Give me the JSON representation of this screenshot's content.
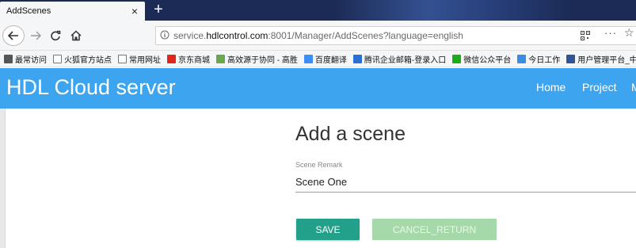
{
  "browser": {
    "tab_title": "AddScenes",
    "tab_close": "×",
    "new_tab": "+",
    "url_prefix": "service.",
    "url_domain": "hdlcontrol.com",
    "url_rest": ":8001/Manager/AddScenes?language=english",
    "more": "···",
    "star": "☆",
    "icons": {
      "back": "back-arrow-icon",
      "forward": "forward-arrow-icon",
      "reload": "reload-icon",
      "home": "home-icon",
      "info": "info-icon",
      "qr": "qr-code-icon",
      "star": "bookmark-star-icon"
    }
  },
  "bookmarks": [
    {
      "label": "最常访问",
      "icon": "gear-star-icon",
      "color": "#555555"
    },
    {
      "label": "火狐官方站点",
      "icon": "folder-icon",
      "color": "#777777"
    },
    {
      "label": "常用网址",
      "icon": "folder-icon",
      "color": "#777777"
    },
    {
      "label": "京东商城",
      "icon": "jd-icon",
      "color": "#e1251b"
    },
    {
      "label": "高效源于协同 - 高胜",
      "icon": "gear-icon",
      "color": "#6aa84f"
    },
    {
      "label": "百度翻译",
      "icon": "baidu-translate-icon",
      "color": "#3e8ef7"
    },
    {
      "label": "腾讯企业邮箱-登录入口",
      "icon": "mail-icon",
      "color": "#2b6fd6"
    },
    {
      "label": "微信公众平台",
      "icon": "wechat-icon",
      "color": "#1aad19"
    },
    {
      "label": "今日工作",
      "icon": "work-icon",
      "color": "#3a8de0"
    },
    {
      "label": "用户管理平台_中国",
      "icon": "platform-icon",
      "color": "#2f5597"
    }
  ],
  "app": {
    "brand": "HDL Cloud server",
    "nav": {
      "home": "Home",
      "project": "Project",
      "more": "M"
    },
    "accent_color": "#3da5f0"
  },
  "form": {
    "title": "Add a scene",
    "remark_label": "Scene Remark",
    "remark_value": "Scene One",
    "save_label": "SAVE",
    "cancel_label": "CANCEL_RETURN",
    "save_color": "#23a08a",
    "cancel_color": "#a6d9a9"
  }
}
